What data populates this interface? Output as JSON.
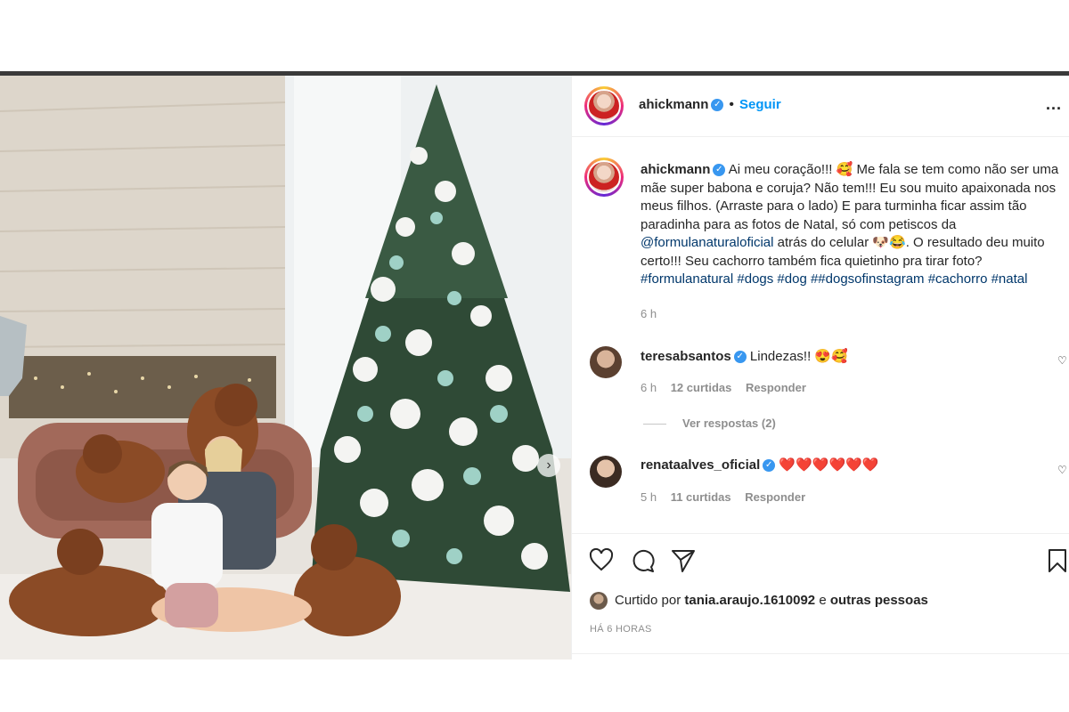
{
  "post": {
    "username": "ahickmann",
    "verified_mark": "✓",
    "dot": "•",
    "follow_label": "Seguir",
    "more_label": "...",
    "next_label": "›"
  },
  "caption": {
    "username": "ahickmann",
    "text_1": "Ai meu coração!!! 🥰 Me fala se tem como não ser uma mãe super babona e coruja? Não tem!!! Eu sou muito apaixonada nos meus filhos. (Arraste para o lado) E para turminha ficar assim tão paradinha para as fotos de Natal, só com petiscos da ",
    "mention": "@formulanaturaloficial",
    "text_2": " atrás do celular 🐶😂. O resultado deu muito certo!!! Seu cachorro também fica quietinho pra tirar foto? ",
    "hashtags": "#formulanatural #dogs #dog ##dogsofinstagram #cachorro #natal",
    "time": "6 h"
  },
  "comments": [
    {
      "username": "teresabsantos",
      "text": "Lindezas!! 😍🥰",
      "time": "6 h",
      "likes": "12 curtidas",
      "reply": "Responder",
      "view_replies": "Ver respostas (2)"
    },
    {
      "username": "renataalves_oficial",
      "text": "❤️❤️❤️❤️❤️❤️",
      "time": "5 h",
      "likes": "11 curtidas",
      "reply": "Responder"
    }
  ],
  "footer": {
    "liked_prefix": "Curtido por",
    "liked_user": "tania.araujo.1610092",
    "liked_and": "e",
    "liked_others": "outras pessoas",
    "ago": "HÁ 6 HORAS"
  },
  "icons": [
    "heart-icon",
    "comment-icon",
    "share-icon",
    "bookmark-icon",
    "more-icon",
    "verified-icon",
    "chevron-right-icon"
  ],
  "colors": {
    "link": "#00376b",
    "follow": "#0095f6",
    "verified": "#3897f0",
    "muted": "#8e8e8e"
  }
}
